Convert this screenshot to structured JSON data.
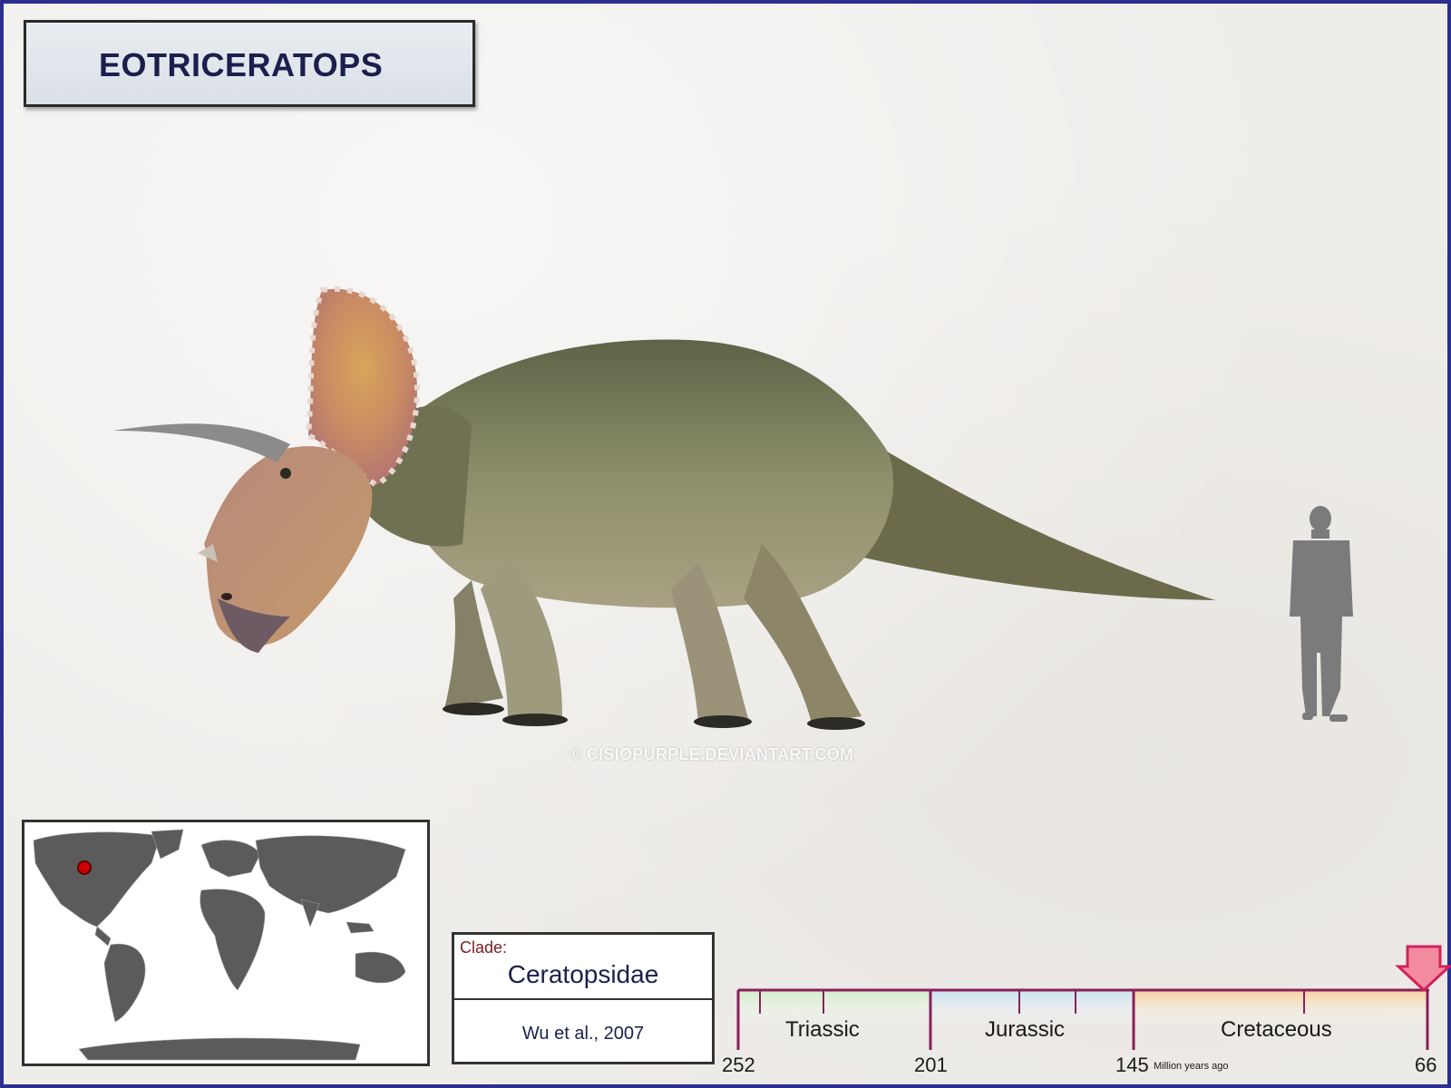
{
  "title": "EOTRICERATOPS",
  "watermark": "© CISIOPURPLE.DEVIANTART.COM",
  "clade": {
    "label": "Clade:",
    "name": "Ceratopsidae",
    "author": "Wu et al., 2007"
  },
  "timeline": {
    "periods": [
      "Triassic",
      "Jurassic",
      "Cretaceous"
    ],
    "ticks": [
      "252",
      "201",
      "145",
      "66"
    ],
    "unit": "Million years ago"
  },
  "colors": {
    "border": "#2b2f8f",
    "title_text": "#1a1f4d",
    "timeline_line": "#8a1f5a",
    "arrow": "#f26d8b"
  }
}
